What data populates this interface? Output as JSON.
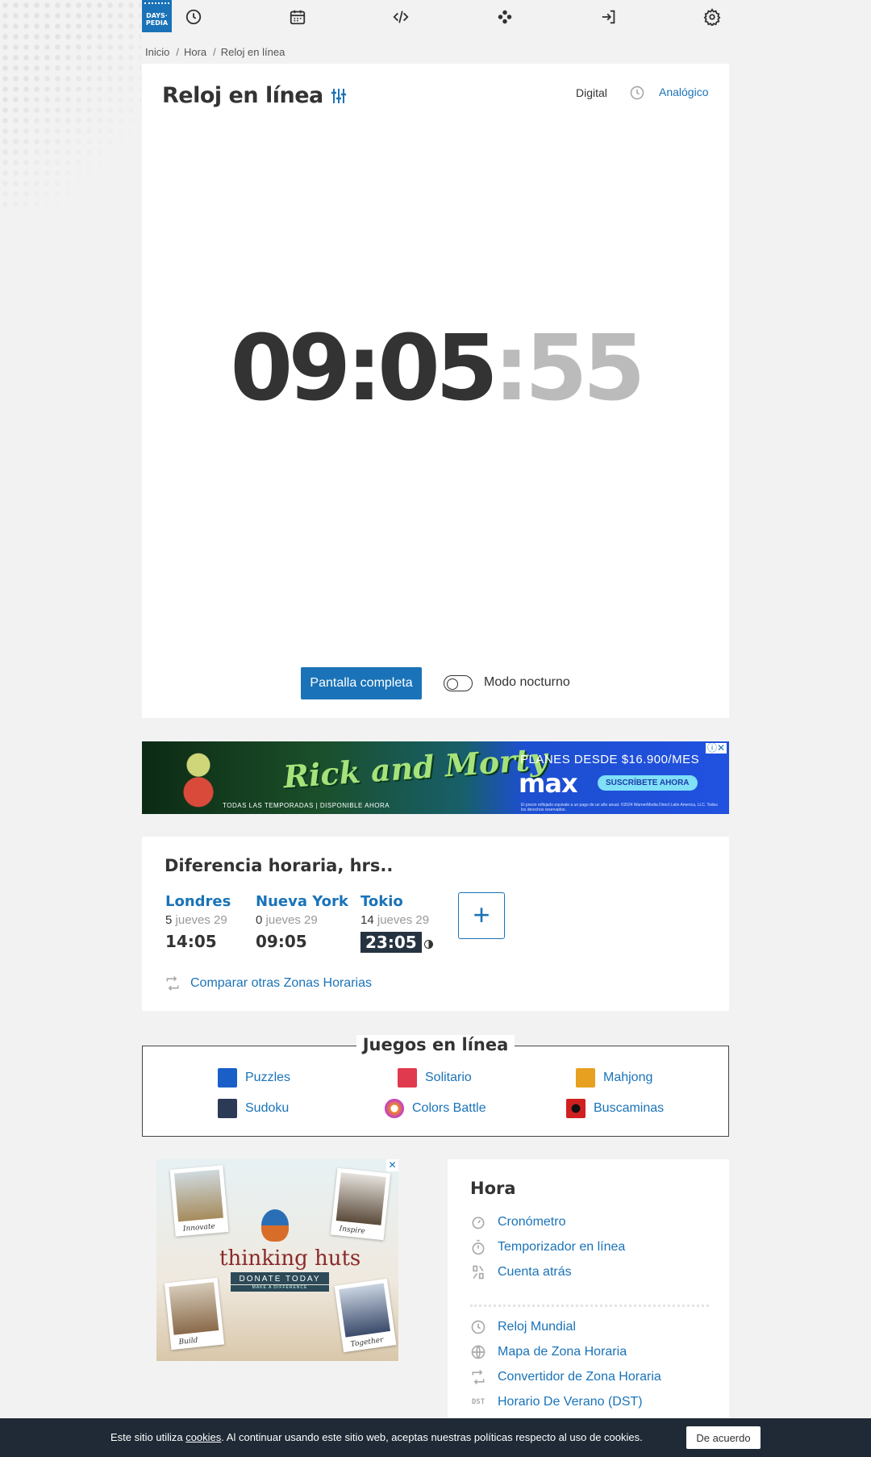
{
  "logo": {
    "line1": "DAYS·",
    "line2": "PEDIA"
  },
  "nav": {
    "icons": [
      "clock-icon",
      "calendar-icon",
      "code-icon",
      "games-icon",
      "login-icon",
      "gear-icon"
    ]
  },
  "breadcrumb": {
    "items": [
      "Inicio",
      "Hora",
      "Reloj en línea"
    ]
  },
  "clock": {
    "title": "Reloj en línea",
    "mode_digital": "Digital",
    "mode_analog": "Analógico",
    "hours_minutes": "09:05",
    "seconds": ":55",
    "fullscreen_label": "Pantalla completa",
    "night_mode_label": "Modo nocturno",
    "night_mode_on": false
  },
  "ad1": {
    "headline": "Rick and Morty",
    "tagline": "TODAS LAS TEMPORADAS | DISPONIBLE AHORA",
    "offer": "PLANES DESDE $16.900/MES",
    "brand": "max",
    "cta": "SUSCRÍBETE AHORA",
    "fine_print": "El precio reflejado equivale a un pago de un año anual. ©2024 WarnerMedia Direct Latin America, LLC. Todos los derechos reservados.",
    "close": "ⓘ✕"
  },
  "timezones": {
    "title": "Diferencia horaria, hrs..",
    "cities": [
      {
        "name": "Londres",
        "diff": "5",
        "day": "jueves 29",
        "time": "14:05",
        "night": false
      },
      {
        "name": "Nueva York",
        "diff": "0",
        "day": "jueves 29",
        "time": "09:05",
        "night": false
      },
      {
        "name": "Tokio",
        "diff": "14",
        "day": "jueves 29",
        "time": "23:05",
        "night": true
      }
    ],
    "add_label": "+",
    "compare_label": "Comparar otras Zonas Horarias"
  },
  "games": {
    "title": "Juegos en línea",
    "items": [
      {
        "label": "Puzzles",
        "icon": "puzzles-icon",
        "color": "#1a5fc8"
      },
      {
        "label": "Solitario",
        "icon": "solitaire-icon",
        "color": "#e03a4e"
      },
      {
        "label": "Mahjong",
        "icon": "mahjong-icon",
        "color": "#e8a020"
      },
      {
        "label": "Sudoku",
        "icon": "sudoku-icon",
        "color": "#2b3a55"
      },
      {
        "label": "Colors Battle",
        "icon": "colors-battle-icon",
        "color": "#f08a24"
      },
      {
        "label": "Buscaminas",
        "icon": "minesweeper-icon",
        "color": "#d02020"
      }
    ]
  },
  "ad2": {
    "brand": "thinking huts",
    "cta": "DONATE TODAY",
    "sub": "MAKE A DIFFERENCE",
    "captions": [
      "Innovate",
      "Inspire",
      "Build",
      "Together"
    ],
    "close": "✕"
  },
  "side": {
    "title": "Hora",
    "group1": [
      {
        "label": "Cronómetro",
        "icon": "stopwatch-icon"
      },
      {
        "label": "Temporizador en línea",
        "icon": "timer-icon"
      },
      {
        "label": "Cuenta atrás",
        "icon": "countdown-icon"
      }
    ],
    "group2": [
      {
        "label": "Reloj Mundial",
        "icon": "clock-icon"
      },
      {
        "label": "Mapa de Zona Horaria",
        "icon": "globe-icon"
      },
      {
        "label": "Convertidor de Zona Horaria",
        "icon": "convert-icon"
      },
      {
        "label": "Horario De Verano (DST)",
        "icon": "dst-icon",
        "icon_text": "DST"
      }
    ]
  },
  "cookie": {
    "prefix": "Este sitio utiliza ",
    "link": "cookies",
    "suffix": ". Al continuar usando este sitio web, aceptas nuestras políticas respecto al uso de cookies.",
    "ok_label": "De acuerdo"
  },
  "colors": {
    "accent": "#1a73b8",
    "dark": "#333333",
    "cookie_bg": "#1f2a36",
    "night_bg": "#263341"
  }
}
